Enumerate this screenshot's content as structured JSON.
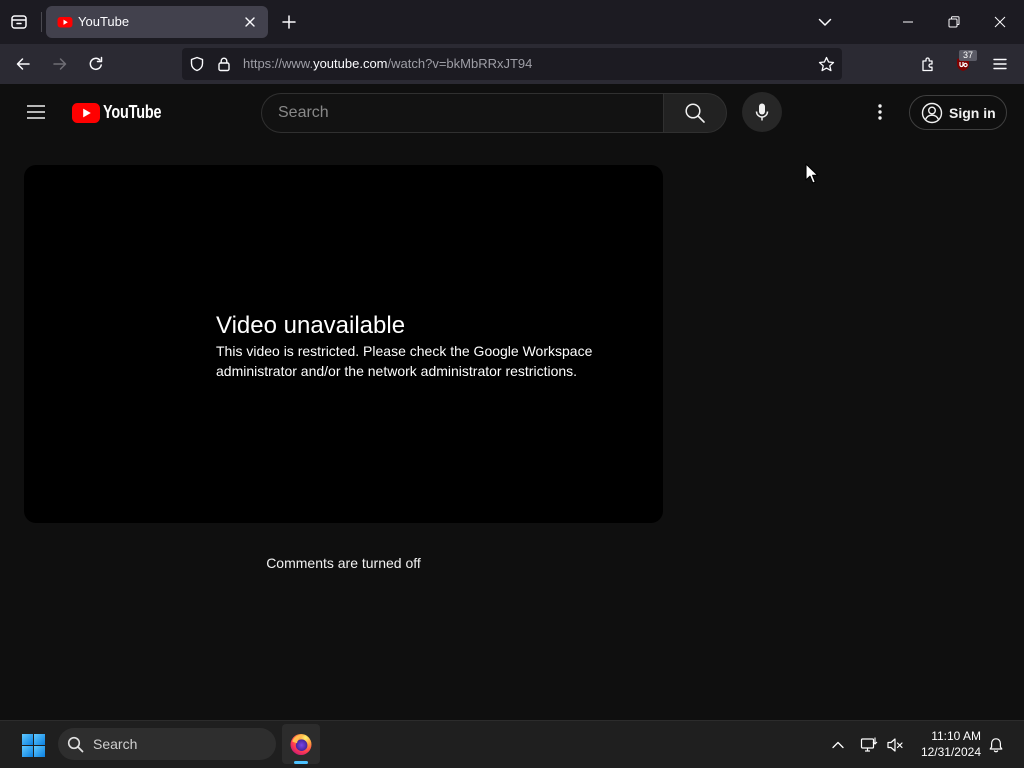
{
  "browser": {
    "tab": {
      "title": "YouTube",
      "favicon": "youtube-favicon-icon"
    },
    "address_bar": {
      "url_scheme": "https://www.",
      "url_domain": "youtube.com",
      "url_path": "/watch?v=bkMbRRxJT94"
    },
    "extensions": {
      "ublock_badge": "37"
    }
  },
  "youtube": {
    "logo_text": "YouTube",
    "search": {
      "placeholder": "Search"
    },
    "sign_in_label": "Sign in",
    "player": {
      "title": "Video unavailable",
      "message_lines": [
        "This video is restricted. Please check the Google Workspace",
        "administrator and/or the network administrator restrictions."
      ]
    },
    "comments_status": "Comments are turned off"
  },
  "taskbar": {
    "search_label": "Search",
    "apps": [
      {
        "icon": "firefox-icon",
        "active": true
      }
    ],
    "clock": {
      "time": "11:10 AM",
      "date": "12/31/2024"
    }
  },
  "colors": {
    "youtube_red": "#ff0000",
    "page_background": "#0f0f0f",
    "player_background": "#000000",
    "active_app_indicator": "#4cc2ff"
  }
}
